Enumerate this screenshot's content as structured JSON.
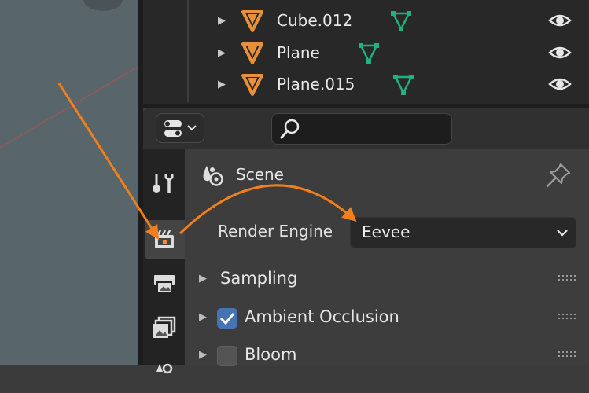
{
  "outliner": {
    "rows": [
      {
        "name": "Cube.012"
      },
      {
        "name": "Plane"
      },
      {
        "name": "Plane.015"
      }
    ]
  },
  "properties": {
    "header": {
      "search_placeholder": ""
    },
    "scene": {
      "label": "Scene"
    },
    "render_engine": {
      "label": "Render Engine",
      "value": "Eevee"
    },
    "panels": [
      {
        "title": "Sampling",
        "has_checkbox": false
      },
      {
        "title": "Ambient Occlusion",
        "has_checkbox": true,
        "checked": true
      },
      {
        "title": "Bloom",
        "has_checkbox": true,
        "checked": false
      }
    ]
  },
  "colors": {
    "object_icon": "#e8913a",
    "mesh_icon": "#20b27e",
    "arrow": "#f07f1c",
    "checkbox_on": "#4772b3",
    "viewport_bg": "#58656a"
  }
}
